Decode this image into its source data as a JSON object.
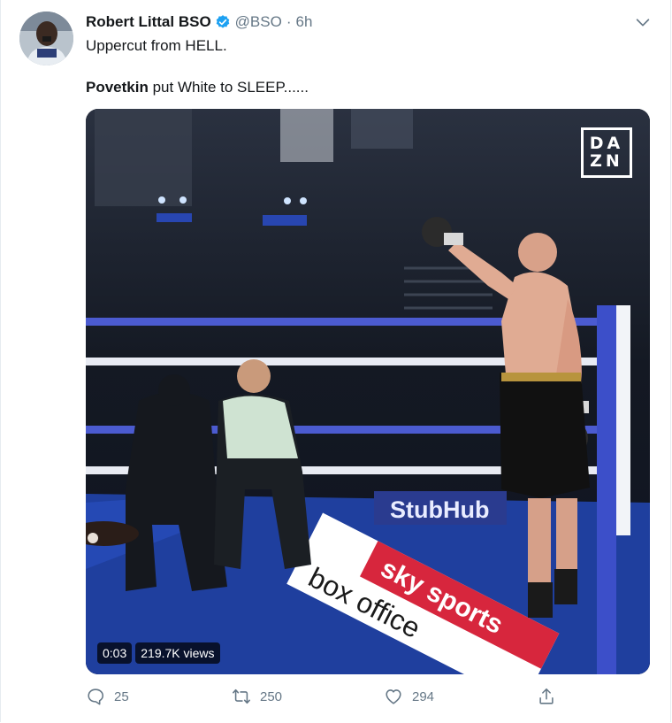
{
  "tweet": {
    "display_name": "Robert Littal BSO",
    "handle": "@BSO",
    "separator": "·",
    "time": "6h",
    "line1": "Uppercut from HELL.",
    "line2_bold": "Povetkin",
    "line2_rest": " put White to SLEEP......"
  },
  "media": {
    "logo_top": "DA",
    "logo_bottom": "ZN",
    "timestamp": "0:03",
    "views": "219.7K views",
    "banner_text": "StubHub",
    "mat_text_1": "sky sports",
    "mat_text_2": "box office"
  },
  "actions": {
    "replies": "25",
    "retweets": "250",
    "likes": "294"
  },
  "icons": {
    "verified": "verified-badge-icon",
    "caret": "chevron-down-icon",
    "reply": "reply-icon",
    "retweet": "retweet-icon",
    "like": "heart-icon",
    "share": "share-icon"
  },
  "colors": {
    "verified_blue": "#1da1f2",
    "secondary_text": "#657786",
    "mat_blue": "#1f3f9e",
    "sky_red": "#d7263d"
  }
}
